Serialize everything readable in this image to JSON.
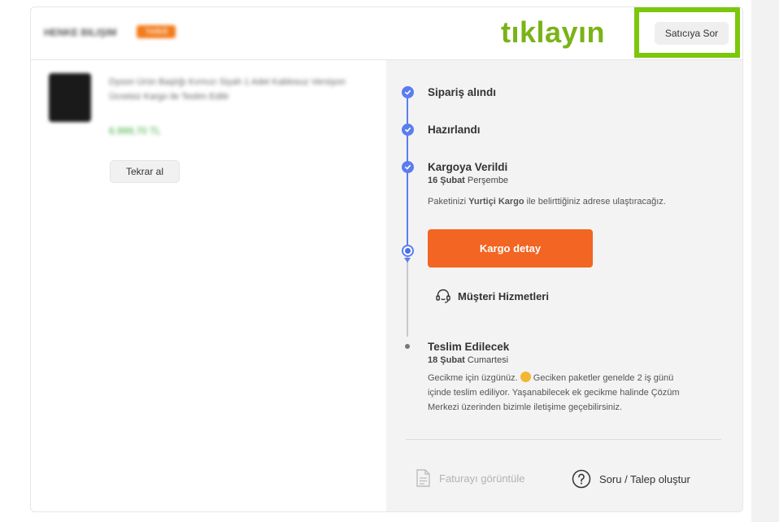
{
  "header": {
    "seller_name": "HENKE BILIŞIM",
    "seller_badge": "Yetkili",
    "hint_text": "tıklayın",
    "ask_seller_label": "Satıcıya Sor"
  },
  "product": {
    "name": "Dyson Ürün Başlığı Kırmızı Siyah 1 Adet Kablosuz Versiyon Ücretsiz Kargo ile Teslim Edilir",
    "price": "6.999,70 TL",
    "rebuy_label": "Tekrar al"
  },
  "timeline": {
    "steps": [
      {
        "title": "Sipariş alındı"
      },
      {
        "title": "Hazırlandı"
      },
      {
        "title": "Kargoya Verildi",
        "date_bold": "16 Şubat",
        "date_rest": " Perşembe"
      }
    ],
    "shipping_info_prefix": "Paketinizi ",
    "shipping_company": "Yurtiçi Kargo",
    "shipping_info_suffix": " ile belirttiğiniz adrese ulaştıracağız.",
    "cargo_button_label": "Kargo detay",
    "support_label": "Müşteri Hizmetleri",
    "delivery": {
      "title": "Teslim Edilecek",
      "date_bold": "18 Şubat",
      "date_rest": " Cumartesi",
      "delay_line1_a": "Gecikme için üzgünüz. ",
      "delay_line1_b": " Geciken paketler genelde 2 iş günü",
      "delay_line2": "içinde teslim ediliyor. Yaşanabilecek ek gecikme halinde Çözüm",
      "delay_line3": "Merkezi üzerinden bizimle iletişime geçebilirsiniz."
    }
  },
  "footer": {
    "invoice_label": "Faturayı görüntüle",
    "request_label": "Soru / Talep oluştur"
  },
  "colors": {
    "accent_blue": "#5b7df0",
    "cargo_orange": "#f26522",
    "hint_green": "#7ac70c"
  }
}
